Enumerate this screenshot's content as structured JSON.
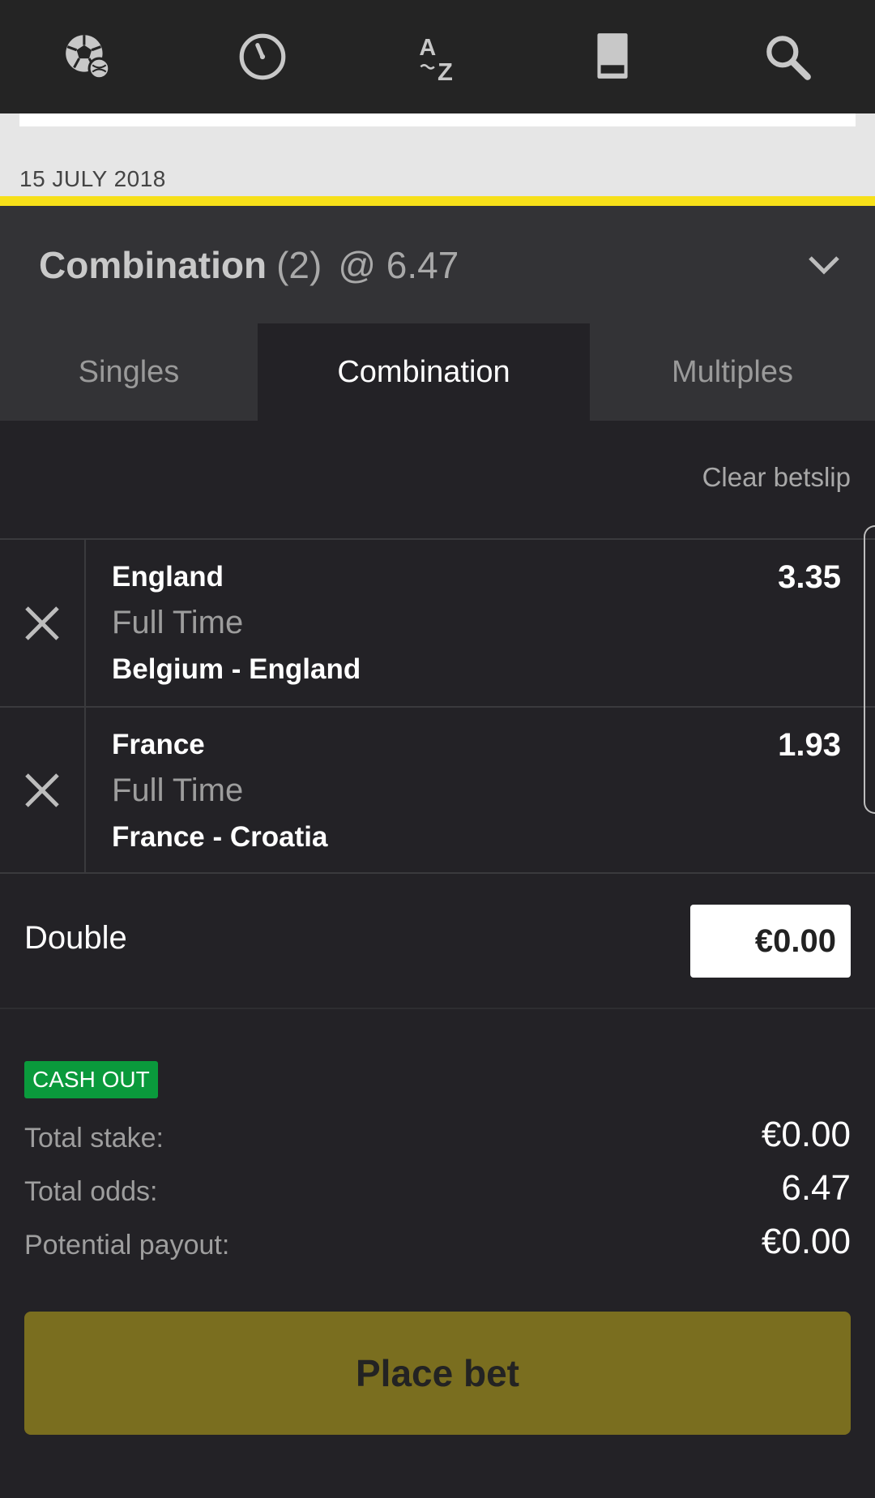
{
  "topnav": {
    "icons": [
      "sports-ball-icon",
      "clock-icon",
      "a-to-z-icon",
      "betslip-icon",
      "search-icon"
    ],
    "a_letter": "A",
    "z_letter": "Z"
  },
  "date_header": "15 JULY 2018",
  "betslip": {
    "type_label": "Combination",
    "count": "(2)",
    "total_odds": "@ 6.47"
  },
  "tabs": [
    {
      "label": "Singles"
    },
    {
      "label": "Combination"
    },
    {
      "label": "Multiples"
    }
  ],
  "clear_label": "Clear betslip",
  "selections": [
    {
      "team": "England",
      "market": "Full Time",
      "event": "Belgium - England",
      "odds": "3.35"
    },
    {
      "team": "France",
      "market": "Full Time",
      "event": "France - Croatia",
      "odds": "1.93"
    }
  ],
  "double": {
    "label": "Double",
    "stake": "€0.00"
  },
  "cashout_badge": "CASH OUT",
  "summary": {
    "total_stake_label": "Total stake:",
    "total_stake_value": "€0.00",
    "total_odds_label": "Total odds:",
    "total_odds_value": "6.47",
    "payout_label": "Potential payout:",
    "payout_value": "€0.00"
  },
  "place_bet_label": "Place bet",
  "colors": {
    "accent_yellow": "#f7e019",
    "place_bet_bg": "#7a6e1f",
    "cashout_green": "#0a9a3c",
    "background": "#232226"
  }
}
